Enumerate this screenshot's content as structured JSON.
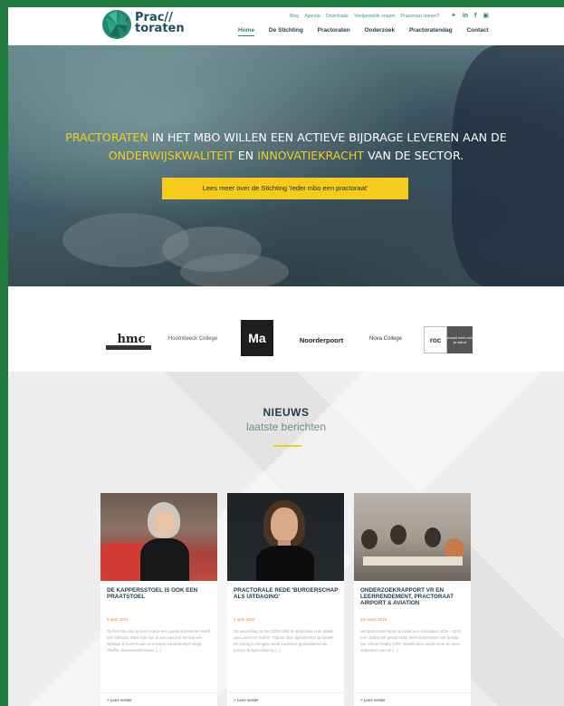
{
  "header": {
    "logo_line1": "Prac//",
    "logo_line2": "toraten",
    "top_links": [
      "Blog",
      "Agenda",
      "Downloads",
      "Veelgestelde vragen",
      "Practoraat starten?"
    ],
    "social": [
      "twitter-icon",
      "linkedin-icon",
      "facebook-icon",
      "youtube-icon"
    ],
    "nav": [
      "Home",
      "De Stichting",
      "Practoraten",
      "Onderzoek",
      "Practoratendag",
      "Contact"
    ]
  },
  "hero": {
    "line1_hl": "PRACTORATEN",
    "line1_rest": " IN HET MBO WILLEN EEN ACTIEVE BIJDRAGE LEVEREN AAN DE",
    "line2_hl1": "ONDERWIJSKWALITEIT",
    "line2_mid": " EN ",
    "line2_hl2": "INNOVATIEKRACHT",
    "line2_rest": " VAN DE SECTOR.",
    "button": "Lees meer over de Stichting 'Ieder mbo een practoraat'",
    "accent_color": "#f2cf1a"
  },
  "partners": {
    "hmc": "hmc",
    "hoorn": "Hoornbeeck College",
    "ma": "Ma",
    "noord": "Noorderpoort",
    "nova": "Nova College",
    "roc": "roc",
    "roc_tag": "maakt werk van je talent"
  },
  "news": {
    "title": "NIEUWS",
    "subtitle": "laatste berichten",
    "cards": [
      {
        "title": "DE KAPPERSSTOEL IS OOK EEN PRAATSTOEL",
        "date": "9 april 2019",
        "excerpt": "Op het mbo kun je leren hoe je een goede kinnenman wordt. Een vakman. Maar hoe kun je ons vanuit je beroep een bijdrage te leveren aan een betere samenleving? Birgit Pfeiffer, docentonderzoeker [...]",
        "more": "> Lees verder"
      },
      {
        "title": "PRACTORALE REDE 'BURGERSCHAP ALS UITDAGING'",
        "date": "4 april 2019",
        "excerpt": "Op woensdag 15 mei 2019 vindt de practorale rede plaats van Laurence Guérin. Tijdens deze bijeenkomst op locatie De Gebrij in Hengelo wordt Laurence geïnstalleerd als practor Burgerschap bij [...]",
        "more": "> Lees verder"
      },
      {
        "title": "ONDERZOEKRAPPORT VR EN LEERRENDEMENT, PRACTORAAT AIRPORT & AVIATION",
        "date": "18 maart 2019",
        "excerpt": "Het practoraat Airport & Aviation is schooljaar 2018 – 2019 een onderzoek gestart naar leerrendementen met behulp van Virtual Reality (VR). Gamification wordt meer en meer onderdeel van het [...]",
        "more": "> Lees verder"
      }
    ]
  }
}
